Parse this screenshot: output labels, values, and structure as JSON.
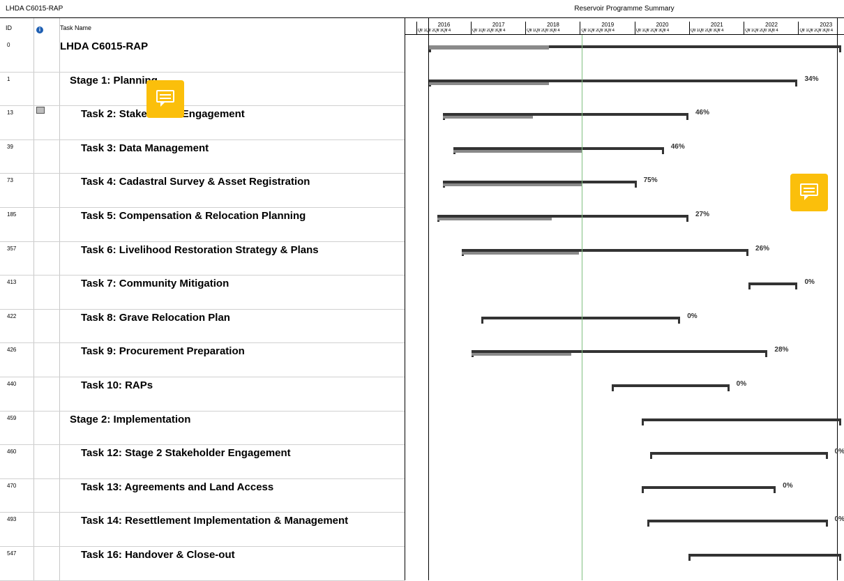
{
  "header": {
    "doc_title": "LHDA C6015-RAP",
    "chart_title": "Reservoir Programme Summary",
    "col_id": "ID",
    "col_info": "i",
    "col_task": "Task Name"
  },
  "timescale": {
    "years": [
      "2016",
      "2017",
      "2018",
      "2019",
      "2020",
      "2021",
      "2022",
      "2023"
    ],
    "quarter_label": "Qtr 1Qtr 2Qtr 3Qtr 4"
  },
  "status_date": 2019.0,
  "chart_data": {
    "type": "gantt",
    "title": "Reservoir Programme Summary",
    "xlim": [
      2015.75,
      2023.8
    ],
    "tasks": [
      {
        "id": "0",
        "name": "LHDA C6015-RAP",
        "level": 0,
        "start": 2016.2,
        "end": 2023.75,
        "progress_end": 2018.4,
        "pct": ""
      },
      {
        "id": "1",
        "name": "Stage 1: Planning",
        "level": 1,
        "start": 2016.2,
        "end": 2022.95,
        "progress_end": 2018.4,
        "pct": "34%"
      },
      {
        "id": "13",
        "name": "Task 2: Stakeholder Engagement",
        "level": 2,
        "start": 2016.45,
        "end": 2020.95,
        "progress_end": 2018.1,
        "pct": "46%"
      },
      {
        "id": "39",
        "name": "Task 3: Data Management",
        "level": 2,
        "start": 2016.65,
        "end": 2020.5,
        "progress_end": 2019.0,
        "pct": "46%"
      },
      {
        "id": "73",
        "name": "Task 4: Cadastral Survey & Asset Registration",
        "level": 2,
        "start": 2016.45,
        "end": 2020.0,
        "progress_end": 2019.0,
        "pct": "75%"
      },
      {
        "id": "185",
        "name": "Task 5: Compensation & Relocation Planning",
        "level": 2,
        "start": 2016.35,
        "end": 2020.95,
        "progress_end": 2018.45,
        "pct": "27%"
      },
      {
        "id": "357",
        "name": "Task 6: Livelihood Restoration Strategy & Plans",
        "level": 2,
        "start": 2016.8,
        "end": 2022.05,
        "progress_end": 2018.95,
        "pct": "26%"
      },
      {
        "id": "413",
        "name": "Task 7: Community Mitigation",
        "level": 2,
        "start": 2022.05,
        "end": 2022.95,
        "progress_end": null,
        "pct": "0%"
      },
      {
        "id": "422",
        "name": "Task 8: Grave Relocation Plan",
        "level": 2,
        "start": 2017.15,
        "end": 2020.8,
        "progress_end": null,
        "pct": "0%"
      },
      {
        "id": "426",
        "name": "Task 9: Procurement Preparation",
        "level": 2,
        "start": 2016.98,
        "end": 2022.4,
        "progress_end": 2018.8,
        "pct": "28%"
      },
      {
        "id": "440",
        "name": "Task 10: RAPs",
        "level": 2,
        "start": 2019.55,
        "end": 2021.7,
        "progress_end": null,
        "pct": "0%"
      },
      {
        "id": "459",
        "name": "Stage 2: Implementation",
        "level": 1,
        "start": 2020.1,
        "end": 2023.75,
        "progress_end": null,
        "pct": ""
      },
      {
        "id": "460",
        "name": "Task 12: Stage 2 Stakeholder Engagement",
        "level": 2,
        "start": 2020.25,
        "end": 2023.5,
        "progress_end": null,
        "pct": "0%"
      },
      {
        "id": "470",
        "name": "Task 13: Agreements and Land Access",
        "level": 2,
        "start": 2020.1,
        "end": 2022.55,
        "progress_end": null,
        "pct": "0%"
      },
      {
        "id": "493",
        "name": "Task 14: Resettlement Implementation & Management",
        "level": 2,
        "start": 2020.2,
        "end": 2023.5,
        "progress_end": null,
        "pct": "0%"
      },
      {
        "id": "547",
        "name": "Task 16: Handover & Close-out",
        "level": 2,
        "start": 2020.95,
        "end": 2023.75,
        "progress_end": null,
        "pct": ""
      }
    ]
  },
  "colors": {
    "bar": "#333333",
    "progress": "#8a8a8a",
    "status_line": "#7fbf7f",
    "comment": "#fbbf0b"
  },
  "icons": {
    "info_column": "info-icon",
    "row_note": "note-icon",
    "comment": "comment-icon"
  }
}
